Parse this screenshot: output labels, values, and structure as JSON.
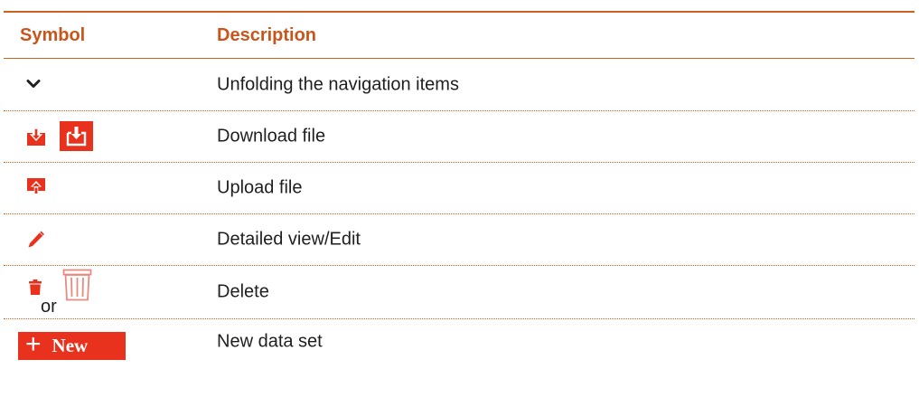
{
  "table": {
    "headers": {
      "symbol": "Symbol",
      "description": "Description"
    },
    "rows": [
      {
        "icon": "chevron-down-icon",
        "description": "Unfolding the navigation items"
      },
      {
        "icon": "download-icon",
        "description": "Download file"
      },
      {
        "icon": "upload-icon",
        "description": "Upload file"
      },
      {
        "icon": "pencil-icon",
        "description": "Detailed view/Edit"
      },
      {
        "icon": "trash-icon",
        "description": "Delete",
        "connector": "or"
      },
      {
        "icon": "plus-icon",
        "description": "New data set",
        "button_label": "New"
      }
    ]
  },
  "colors": {
    "accent": "#c8561c",
    "icon_red": "#e8321e"
  }
}
